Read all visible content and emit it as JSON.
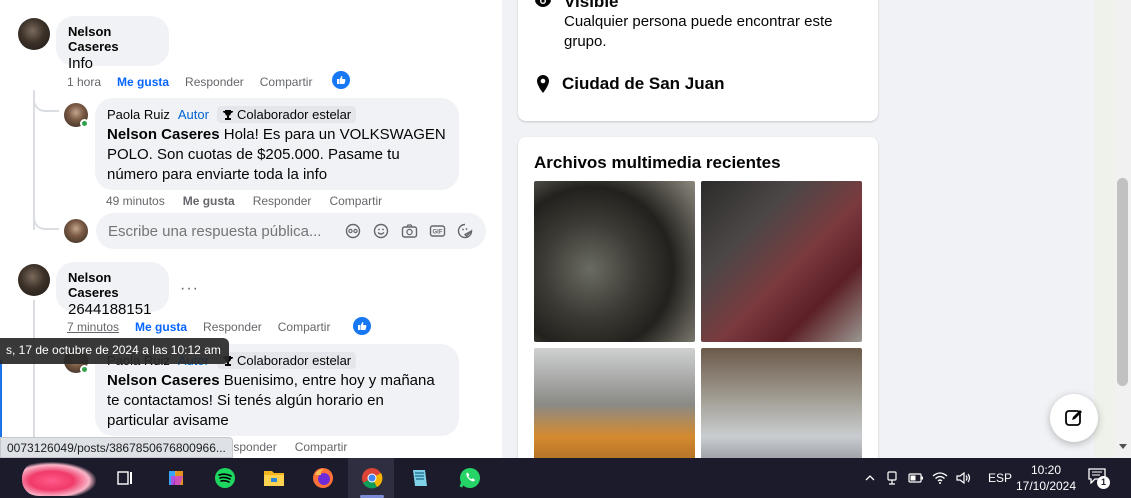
{
  "feed": {
    "comment1": {
      "author": "Nelson Caseres",
      "text": "Info",
      "time": "1 hora",
      "like_label": "Me gusta",
      "reply_label": "Responder",
      "share_label": "Compartir"
    },
    "reply1": {
      "author": "Paola Ruiz",
      "role": "Autor",
      "badge": "Colaborador estelar",
      "mention": "Nelson Caseres",
      "text": " Hola! Es para un VOLKSWAGEN POLO. Son cuotas de $205.000. Pasame tu número para enviarte toda la info",
      "time": "49 minutos",
      "like_label": "Me gusta",
      "reply_label": "Responder",
      "share_label": "Compartir"
    },
    "reply_input": {
      "placeholder": "Escribe una respuesta pública..."
    },
    "comment2": {
      "author": "Nelson Caseres",
      "text": "2644188151",
      "more": "···",
      "time": "7 minutos",
      "like_label": "Me gusta",
      "reply_label": "Responder",
      "share_label": "Compartir"
    },
    "reply2": {
      "author": "Paola Ruiz",
      "role": "Autor",
      "badge": "Colaborador estelar",
      "mention": "Nelson Caseres",
      "text": " Buenisimo, entre hoy y mañana te contactamos! Si tenés algún horario en particular avisame",
      "reply_label": "Responder",
      "share_label": "Compartir"
    },
    "tooltip": "s, 17 de octubre de 2024 a las 10:12 am",
    "status_url": "0073126049/posts/3867850676800966..."
  },
  "sidebar": {
    "about": {
      "visible_title": "Visible",
      "visible_desc": "Cualquier persona puede encontrar este grupo.",
      "location": "Ciudad de San Juan"
    },
    "media": {
      "title": "Archivos multimedia recientes"
    }
  },
  "taskbar": {
    "language": "ESP",
    "time": "10:20",
    "date": "17/10/2024",
    "notification_count": "1"
  },
  "colors": {
    "accent": "#0866ff",
    "taskbar": "#1c1b2b"
  }
}
